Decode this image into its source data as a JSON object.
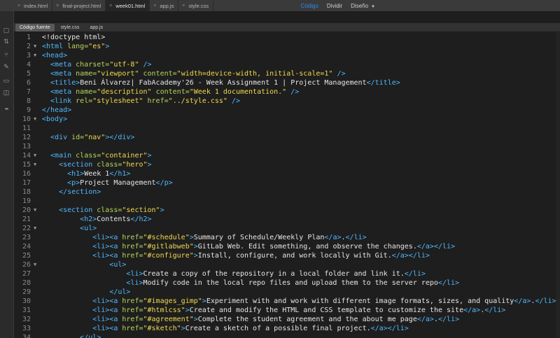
{
  "tabs": [
    {
      "label": "index.html",
      "active": false
    },
    {
      "label": "final-project.html",
      "active": false
    },
    {
      "label": "week01.html",
      "active": true
    },
    {
      "label": "app.js",
      "active": false
    },
    {
      "label": "style.css",
      "active": false
    }
  ],
  "views": {
    "code": "Código",
    "split": "Dividir",
    "design": "Diseño"
  },
  "subtabs": [
    {
      "label": "Código fuente",
      "active": true
    },
    {
      "label": "style.css",
      "active": false
    },
    {
      "label": "app.js",
      "active": false
    }
  ],
  "rail_icons": [
    "files-icon",
    "sort-icon",
    "branch-icon",
    "brush-icon",
    "comment-icon",
    "chat-icon",
    "more-icon"
  ],
  "code_lines": [
    {
      "n": "1",
      "fold": "",
      "indent": 0,
      "tokens": [
        [
          "d",
          "<!doctype html>"
        ]
      ]
    },
    {
      "n": "2",
      "fold": "▼",
      "indent": 0,
      "tokens": [
        [
          "t",
          "<html "
        ],
        [
          "a",
          "lang="
        ],
        [
          "s",
          "\"es\""
        ],
        [
          "t",
          ">"
        ]
      ]
    },
    {
      "n": "3",
      "fold": "▼",
      "indent": 0,
      "tokens": [
        [
          "t",
          "<head>"
        ]
      ]
    },
    {
      "n": "4",
      "fold": "",
      "indent": 2,
      "tokens": [
        [
          "t",
          "<meta "
        ],
        [
          "a",
          "charset="
        ],
        [
          "s",
          "\"utf-8\""
        ],
        [
          "t",
          " />"
        ]
      ]
    },
    {
      "n": "5",
      "fold": "",
      "indent": 2,
      "tokens": [
        [
          "t",
          "<meta "
        ],
        [
          "a",
          "name="
        ],
        [
          "s",
          "\"viewport\""
        ],
        [
          "a",
          " content="
        ],
        [
          "s",
          "\"width=device-width, initial-scale=1\""
        ],
        [
          "t",
          " />"
        ]
      ]
    },
    {
      "n": "6",
      "fold": "",
      "indent": 2,
      "tokens": [
        [
          "t",
          "<title>"
        ],
        [
          "x",
          "Beni Álvarez| FabAcademy'26 - Week Assignment 1 | Project Management"
        ],
        [
          "t",
          "</title>"
        ]
      ]
    },
    {
      "n": "7",
      "fold": "",
      "indent": 2,
      "tokens": [
        [
          "t",
          "<meta "
        ],
        [
          "a",
          "name="
        ],
        [
          "s",
          "\"description\""
        ],
        [
          "a",
          " content="
        ],
        [
          "s",
          "\"Week 1 documentation.\""
        ],
        [
          "t",
          " />"
        ]
      ]
    },
    {
      "n": "8",
      "fold": "",
      "indent": 2,
      "tokens": [
        [
          "t",
          "<link "
        ],
        [
          "a",
          "rel="
        ],
        [
          "s",
          "\"stylesheet\""
        ],
        [
          "a",
          " href="
        ],
        [
          "s",
          "\"../style.css\""
        ],
        [
          "t",
          " />"
        ]
      ]
    },
    {
      "n": "9",
      "fold": "",
      "indent": 0,
      "tokens": [
        [
          "t",
          "</head>"
        ]
      ]
    },
    {
      "n": "10",
      "fold": "▼",
      "indent": 0,
      "tokens": [
        [
          "t",
          "<body>"
        ]
      ]
    },
    {
      "n": "11",
      "fold": "",
      "indent": 0,
      "tokens": []
    },
    {
      "n": "12",
      "fold": "",
      "indent": 2,
      "tokens": [
        [
          "t",
          "<div "
        ],
        [
          "a",
          "id="
        ],
        [
          "s",
          "\"nav\""
        ],
        [
          "t",
          "></div>"
        ]
      ]
    },
    {
      "n": "13",
      "fold": "",
      "indent": 0,
      "tokens": []
    },
    {
      "n": "14",
      "fold": "▼",
      "indent": 2,
      "tokens": [
        [
          "t",
          "<main "
        ],
        [
          "a",
          "class="
        ],
        [
          "s",
          "\"container\""
        ],
        [
          "t",
          ">"
        ]
      ]
    },
    {
      "n": "15",
      "fold": "▼",
      "indent": 4,
      "tokens": [
        [
          "t",
          "<section "
        ],
        [
          "a",
          "class="
        ],
        [
          "s",
          "\"hero\""
        ],
        [
          "t",
          ">"
        ]
      ]
    },
    {
      "n": "16",
      "fold": "",
      "indent": 6,
      "tokens": [
        [
          "t",
          "<h1>"
        ],
        [
          "x",
          "Week 1"
        ],
        [
          "t",
          "</h1>"
        ]
      ]
    },
    {
      "n": "17",
      "fold": "",
      "indent": 6,
      "tokens": [
        [
          "t",
          "<p>"
        ],
        [
          "x",
          "Project Management"
        ],
        [
          "t",
          "</p>"
        ]
      ]
    },
    {
      "n": "18",
      "fold": "",
      "indent": 4,
      "tokens": [
        [
          "t",
          "</section>"
        ]
      ]
    },
    {
      "n": "19",
      "fold": "",
      "indent": 0,
      "tokens": []
    },
    {
      "n": "20",
      "fold": "▼",
      "indent": 4,
      "tokens": [
        [
          "t",
          "<section "
        ],
        [
          "a",
          "class="
        ],
        [
          "s",
          "\"section\""
        ],
        [
          "t",
          ">"
        ]
      ]
    },
    {
      "n": "21",
      "fold": "",
      "indent": 9,
      "tokens": [
        [
          "t",
          "<h2>"
        ],
        [
          "x",
          "Contents"
        ],
        [
          "t",
          "</h2>"
        ]
      ]
    },
    {
      "n": "22",
      "fold": "▼",
      "indent": 9,
      "tokens": [
        [
          "t",
          "<ul>"
        ]
      ]
    },
    {
      "n": "23",
      "fold": "",
      "indent": 12,
      "tokens": [
        [
          "t",
          "<li><a "
        ],
        [
          "a",
          "href="
        ],
        [
          "s",
          "\"#schedule\""
        ],
        [
          "t",
          ">"
        ],
        [
          "x",
          "Summary of Schedule/Weekly Plan"
        ],
        [
          "t",
          "</a>"
        ],
        [
          "x",
          "."
        ],
        [
          "t",
          "</li>"
        ]
      ]
    },
    {
      "n": "24",
      "fold": "",
      "indent": 12,
      "tokens": [
        [
          "t",
          "<li><a "
        ],
        [
          "a",
          "href="
        ],
        [
          "s",
          "\"#gitlabweb\""
        ],
        [
          "t",
          ">"
        ],
        [
          "x",
          "GitLab Web. Edit something, and observe the changes."
        ],
        [
          "t",
          "</a></li>"
        ]
      ]
    },
    {
      "n": "25",
      "fold": "",
      "indent": 12,
      "tokens": [
        [
          "t",
          "<li><a "
        ],
        [
          "a",
          "href="
        ],
        [
          "s",
          "\"#configure\""
        ],
        [
          "t",
          ">"
        ],
        [
          "x",
          "Install, configure, and work locally with Git."
        ],
        [
          "t",
          "</a></li>"
        ]
      ]
    },
    {
      "n": "26",
      "fold": "▼",
      "indent": 16,
      "tokens": [
        [
          "t",
          "<ul>"
        ]
      ]
    },
    {
      "n": "27",
      "fold": "",
      "indent": 20,
      "tokens": [
        [
          "t",
          "<li>"
        ],
        [
          "x",
          "Create a copy of the repository in a local folder and link it."
        ],
        [
          "t",
          "</li>"
        ]
      ]
    },
    {
      "n": "28",
      "fold": "",
      "indent": 20,
      "tokens": [
        [
          "t",
          "<li>"
        ],
        [
          "x",
          "Modify code in the local repo files and upload them to the server repo"
        ],
        [
          "t",
          "</li>"
        ]
      ]
    },
    {
      "n": "29",
      "fold": "",
      "indent": 16,
      "tokens": [
        [
          "t",
          "</ul>"
        ]
      ]
    },
    {
      "n": "30",
      "fold": "",
      "indent": 12,
      "tokens": [
        [
          "t",
          "<li><a "
        ],
        [
          "a",
          "href="
        ],
        [
          "s",
          "\"#images_gimp\""
        ],
        [
          "t",
          ">"
        ],
        [
          "x",
          "Experiment with and work with different image formats, sizes, and quality"
        ],
        [
          "t",
          "</a>"
        ],
        [
          "x",
          "."
        ],
        [
          "t",
          "</li>"
        ]
      ]
    },
    {
      "n": "31",
      "fold": "",
      "indent": 12,
      "tokens": [
        [
          "t",
          "<li><a "
        ],
        [
          "a",
          "href="
        ],
        [
          "s",
          "\"#htmlcss\""
        ],
        [
          "t",
          ">"
        ],
        [
          "x",
          "Create and modify the HTML and CSS template to customize the site"
        ],
        [
          "t",
          "</a>"
        ],
        [
          "x",
          "."
        ],
        [
          "t",
          "</li>"
        ]
      ]
    },
    {
      "n": "32",
      "fold": "",
      "indent": 12,
      "tokens": [
        [
          "t",
          "<li><a "
        ],
        [
          "a",
          "href="
        ],
        [
          "s",
          "\"#agreement\""
        ],
        [
          "t",
          ">"
        ],
        [
          "x",
          "Complete the student agreement and the about me page"
        ],
        [
          "t",
          "</a>"
        ],
        [
          "x",
          "."
        ],
        [
          "t",
          "</li>"
        ]
      ]
    },
    {
      "n": "33",
      "fold": "",
      "indent": 12,
      "tokens": [
        [
          "t",
          "<li><a "
        ],
        [
          "a",
          "href="
        ],
        [
          "s",
          "\"#sketch\""
        ],
        [
          "t",
          ">"
        ],
        [
          "x",
          "Create a sketch of a possible final project."
        ],
        [
          "t",
          "</a></li>"
        ]
      ]
    },
    {
      "n": "34",
      "fold": "",
      "indent": 9,
      "tokens": [
        [
          "t",
          "</ul>"
        ]
      ]
    }
  ]
}
